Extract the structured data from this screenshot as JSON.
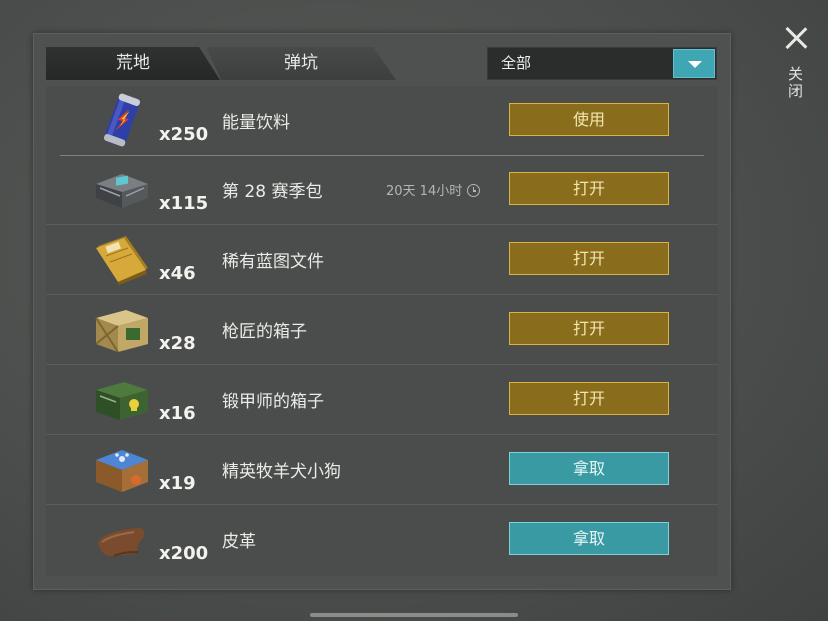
{
  "tabs": [
    {
      "label": "荒地"
    },
    {
      "label": "弹坑"
    }
  ],
  "filter": {
    "selected": "全部"
  },
  "close_label": "关闭",
  "items": [
    {
      "icon": "energy-drink-can-icon",
      "qty": "x250",
      "name": "能量饮料",
      "timer": "",
      "action": "使用",
      "action_style": "gold"
    },
    {
      "icon": "season-pack-crate-icon",
      "qty": "x115",
      "name": "第 28 赛季包",
      "timer": "20天 14小时",
      "action": "打开",
      "action_style": "gold"
    },
    {
      "icon": "blueprint-folder-icon",
      "qty": "x46",
      "name": "稀有蓝图文件",
      "timer": "",
      "action": "打开",
      "action_style": "gold"
    },
    {
      "icon": "wooden-crate-icon",
      "qty": "x28",
      "name": "枪匠的箱子",
      "timer": "",
      "action": "打开",
      "action_style": "gold"
    },
    {
      "icon": "green-skull-crate-icon",
      "qty": "x16",
      "name": "锻甲师的箱子",
      "timer": "",
      "action": "打开",
      "action_style": "gold"
    },
    {
      "icon": "dog-kennel-box-icon",
      "qty": "x19",
      "name": "精英牧羊犬小狗",
      "timer": "",
      "action": "拿取",
      "action_style": "teal"
    },
    {
      "icon": "leather-hide-icon",
      "qty": "x200",
      "name": "皮革",
      "timer": "",
      "action": "拿取",
      "action_style": "teal"
    }
  ],
  "colors": {
    "gold_button": "#8a6d1c",
    "gold_border": "#d9b441",
    "teal_button": "#3a9aa4",
    "teal_border": "#7fd1d9",
    "dropdown_accent": "#3fa6b3"
  }
}
